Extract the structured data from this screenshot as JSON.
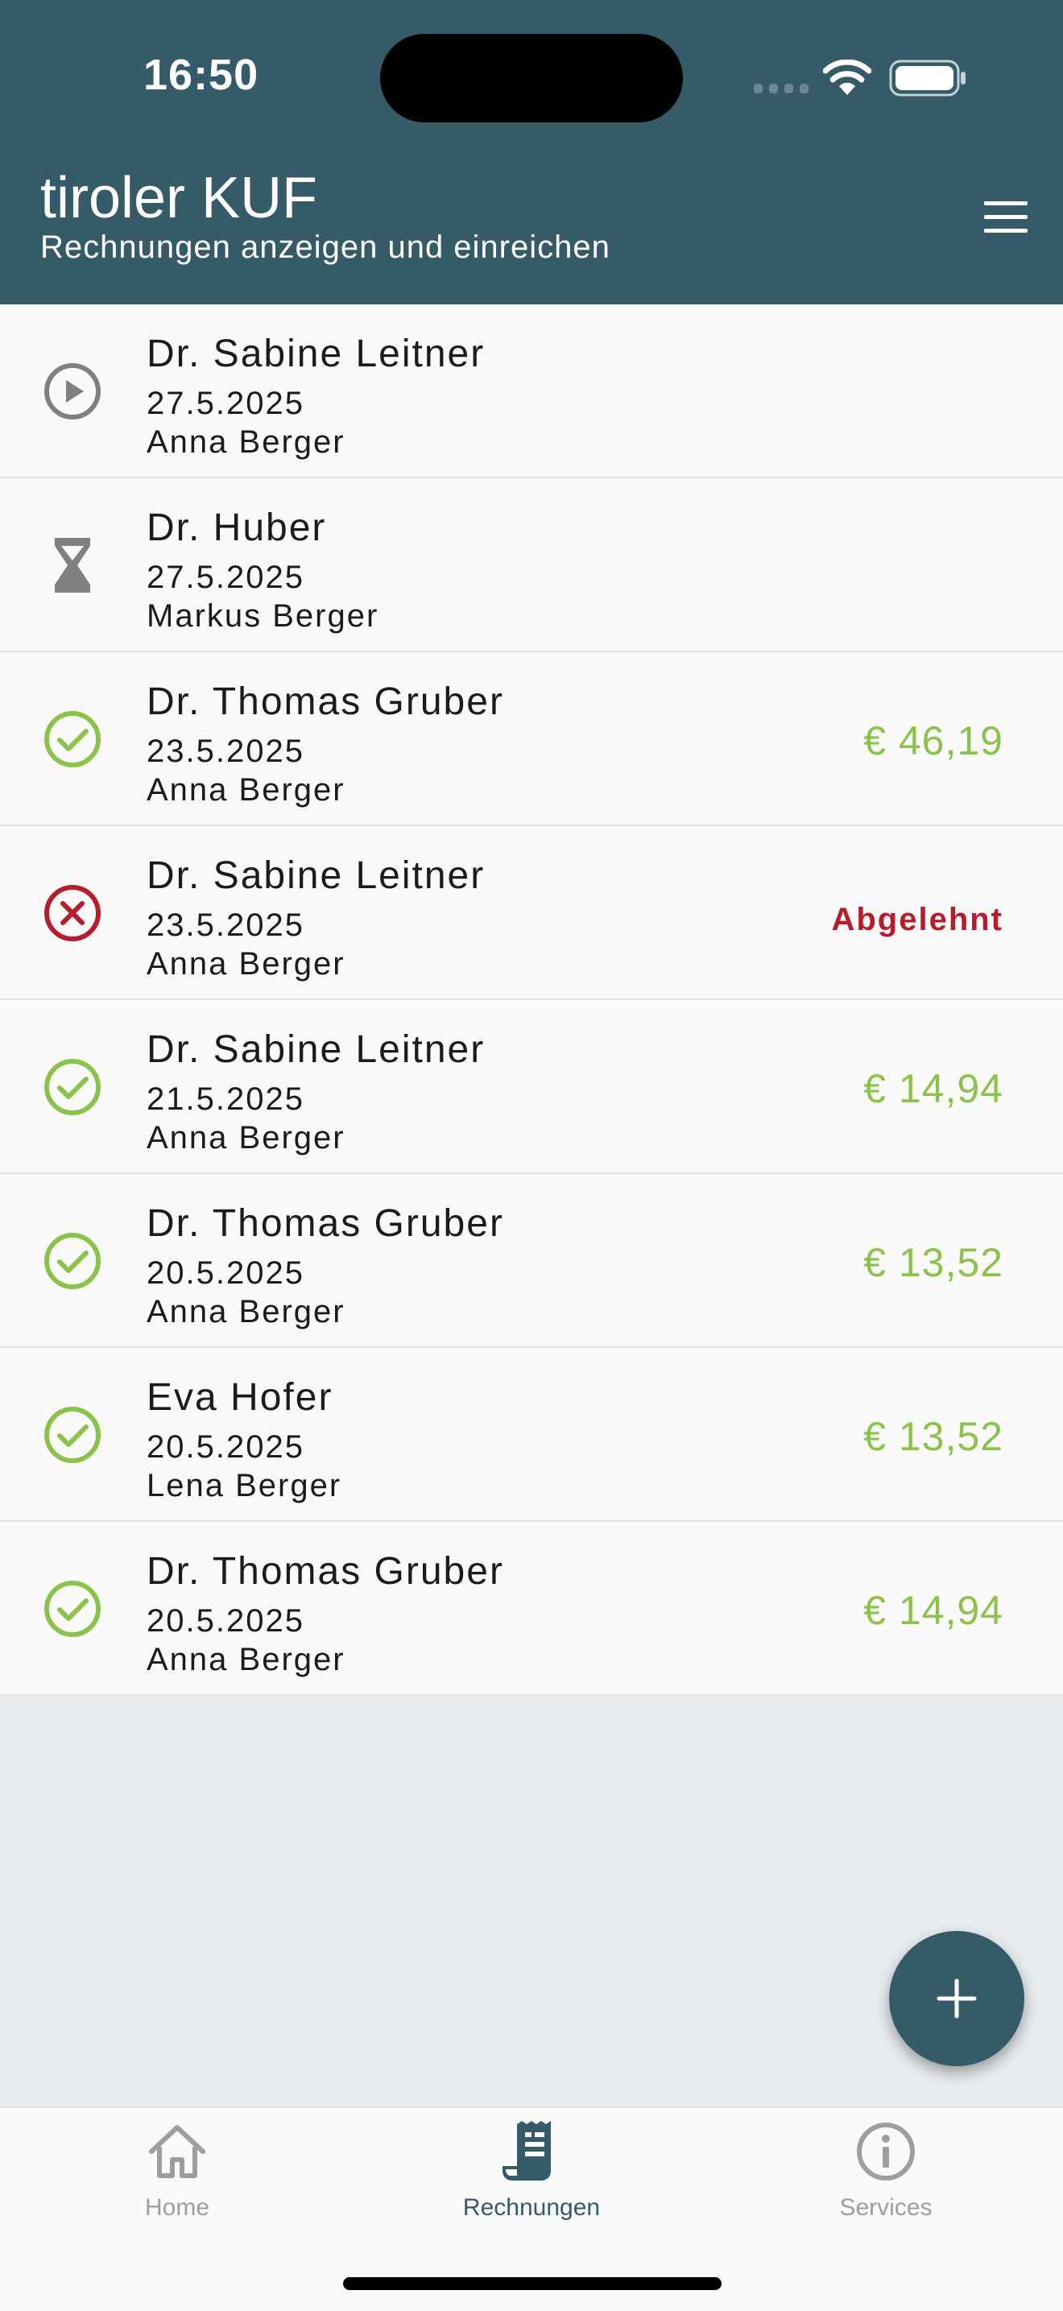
{
  "status_bar": {
    "time": "16:50"
  },
  "header": {
    "title": "tiroler KUF",
    "subtitle": "Rechnungen anzeigen und einreichen",
    "menu_icon": "hamburger-menu-icon"
  },
  "colors": {
    "header_bg": "#355a68",
    "accepted_green": "#8bc34a",
    "rejected_red": "#b71c2c",
    "neutral_icon": "#808080",
    "nav_active": "#355a68",
    "nav_inactive": "#9e9e9e"
  },
  "invoices": [
    {
      "status": "submitted",
      "icon": "play-circle-icon",
      "name": "Dr. Sabine Leitner",
      "date": "27.5.2025",
      "person": "Anna Berger",
      "amount": ""
    },
    {
      "status": "pending",
      "icon": "hourglass-icon",
      "name": "Dr. Huber",
      "date": "27.5.2025",
      "person": "Markus Berger",
      "amount": ""
    },
    {
      "status": "accepted",
      "icon": "check-circle-icon",
      "name": "Dr. Thomas Gruber",
      "date": "23.5.2025",
      "person": "Anna Berger",
      "amount": "€ 46,19"
    },
    {
      "status": "rejected",
      "icon": "x-circle-icon",
      "name": "Dr. Sabine Leitner",
      "date": "23.5.2025",
      "person": "Anna Berger",
      "amount": "Abgelehnt"
    },
    {
      "status": "accepted",
      "icon": "check-circle-icon",
      "name": "Dr. Sabine Leitner",
      "date": "21.5.2025",
      "person": "Anna Berger",
      "amount": "€ 14,94"
    },
    {
      "status": "accepted",
      "icon": "check-circle-icon",
      "name": "Dr. Thomas Gruber",
      "date": "20.5.2025",
      "person": "Anna Berger",
      "amount": "€ 13,52"
    },
    {
      "status": "accepted",
      "icon": "check-circle-icon",
      "name": "Eva Hofer",
      "date": "20.5.2025",
      "person": "Lena Berger",
      "amount": "€ 13,52"
    },
    {
      "status": "accepted",
      "icon": "check-circle-icon",
      "name": "Dr. Thomas Gruber",
      "date": "20.5.2025",
      "person": "Anna Berger",
      "amount": "€ 14,94"
    }
  ],
  "fab": {
    "icon": "plus-icon"
  },
  "bottom_nav": {
    "active": "Rechnungen",
    "items": [
      {
        "label": "Home",
        "icon": "home-icon"
      },
      {
        "label": "Rechnungen",
        "icon": "receipt-icon"
      },
      {
        "label": "Services",
        "icon": "info-circle-icon"
      }
    ]
  }
}
